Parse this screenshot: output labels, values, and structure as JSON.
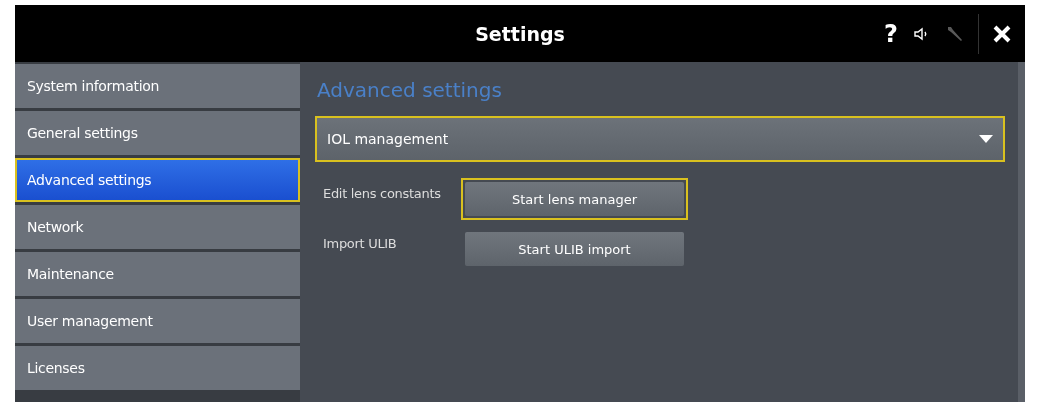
{
  "window": {
    "title": "Settings",
    "toolbar": [
      {
        "kind": "help",
        "label": "?",
        "disabled": false
      },
      {
        "kind": "sound",
        "disabled": false
      },
      {
        "kind": "tools",
        "disabled": true
      },
      {
        "kind": "close",
        "disabled": false
      }
    ]
  },
  "sidebar": {
    "items": [
      {
        "label": "System information",
        "selected": false
      },
      {
        "label": "General settings",
        "selected": false
      },
      {
        "label": "Advanced settings",
        "selected": true
      },
      {
        "label": "Network",
        "selected": false
      },
      {
        "label": "Maintenance",
        "selected": false
      },
      {
        "label": "User management",
        "selected": false
      },
      {
        "label": "Licenses",
        "selected": false
      }
    ]
  },
  "content": {
    "heading": "Advanced settings",
    "dropdown": {
      "value": "IOL management",
      "highlighted": true
    },
    "rows": [
      {
        "label": "Edit lens constants",
        "button": "Start lens manager",
        "highlighted": true
      },
      {
        "label": "Import ULIB",
        "button": "Start ULIB import",
        "highlighted": false
      }
    ]
  }
}
